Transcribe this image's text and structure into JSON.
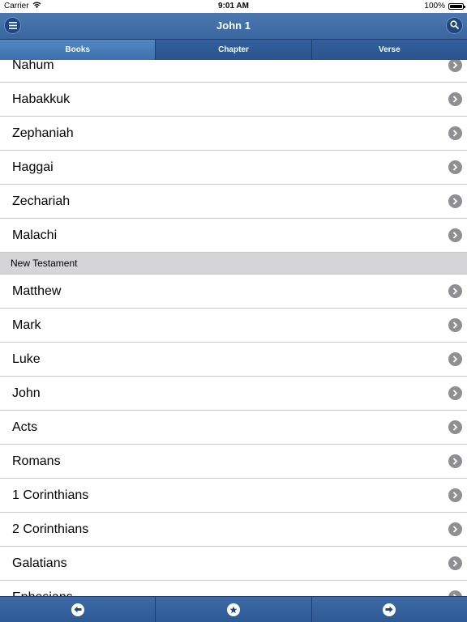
{
  "status_bar": {
    "carrier": "Carrier",
    "time": "9:01 AM",
    "battery": "100%"
  },
  "nav_bar": {
    "title": "John 1",
    "menu_icon": "hamburger-menu-icon",
    "search_icon": "search-icon"
  },
  "tabs": [
    {
      "label": "Books",
      "active": true
    },
    {
      "label": "Chapter",
      "active": false
    },
    {
      "label": "Verse",
      "active": false
    }
  ],
  "old_testament_items": [
    {
      "label": "Nahum"
    },
    {
      "label": "Habakkuk"
    },
    {
      "label": "Zephaniah"
    },
    {
      "label": "Haggai"
    },
    {
      "label": "Zechariah"
    },
    {
      "label": "Malachi"
    }
  ],
  "new_testament_section": {
    "label": "New Testament"
  },
  "new_testament_items": [
    {
      "label": "Matthew"
    },
    {
      "label": "Mark"
    },
    {
      "label": "Luke"
    },
    {
      "label": "John"
    },
    {
      "label": "Acts"
    },
    {
      "label": "Romans"
    },
    {
      "label": "1 Corinthians"
    },
    {
      "label": "2 Corinthians"
    },
    {
      "label": "Galatians"
    },
    {
      "label": "Ephesians"
    }
  ],
  "toolbar": {
    "items": [
      {
        "icon": "arrow-left-icon"
      },
      {
        "icon": "star-icon"
      },
      {
        "icon": "arrow-right-icon"
      }
    ]
  },
  "colors": {
    "nav_blue": "#3a66a0",
    "tab_active": "#4a80bd",
    "section_gray": "#d5d5d7",
    "chevron_gray": "#8e8e93"
  }
}
